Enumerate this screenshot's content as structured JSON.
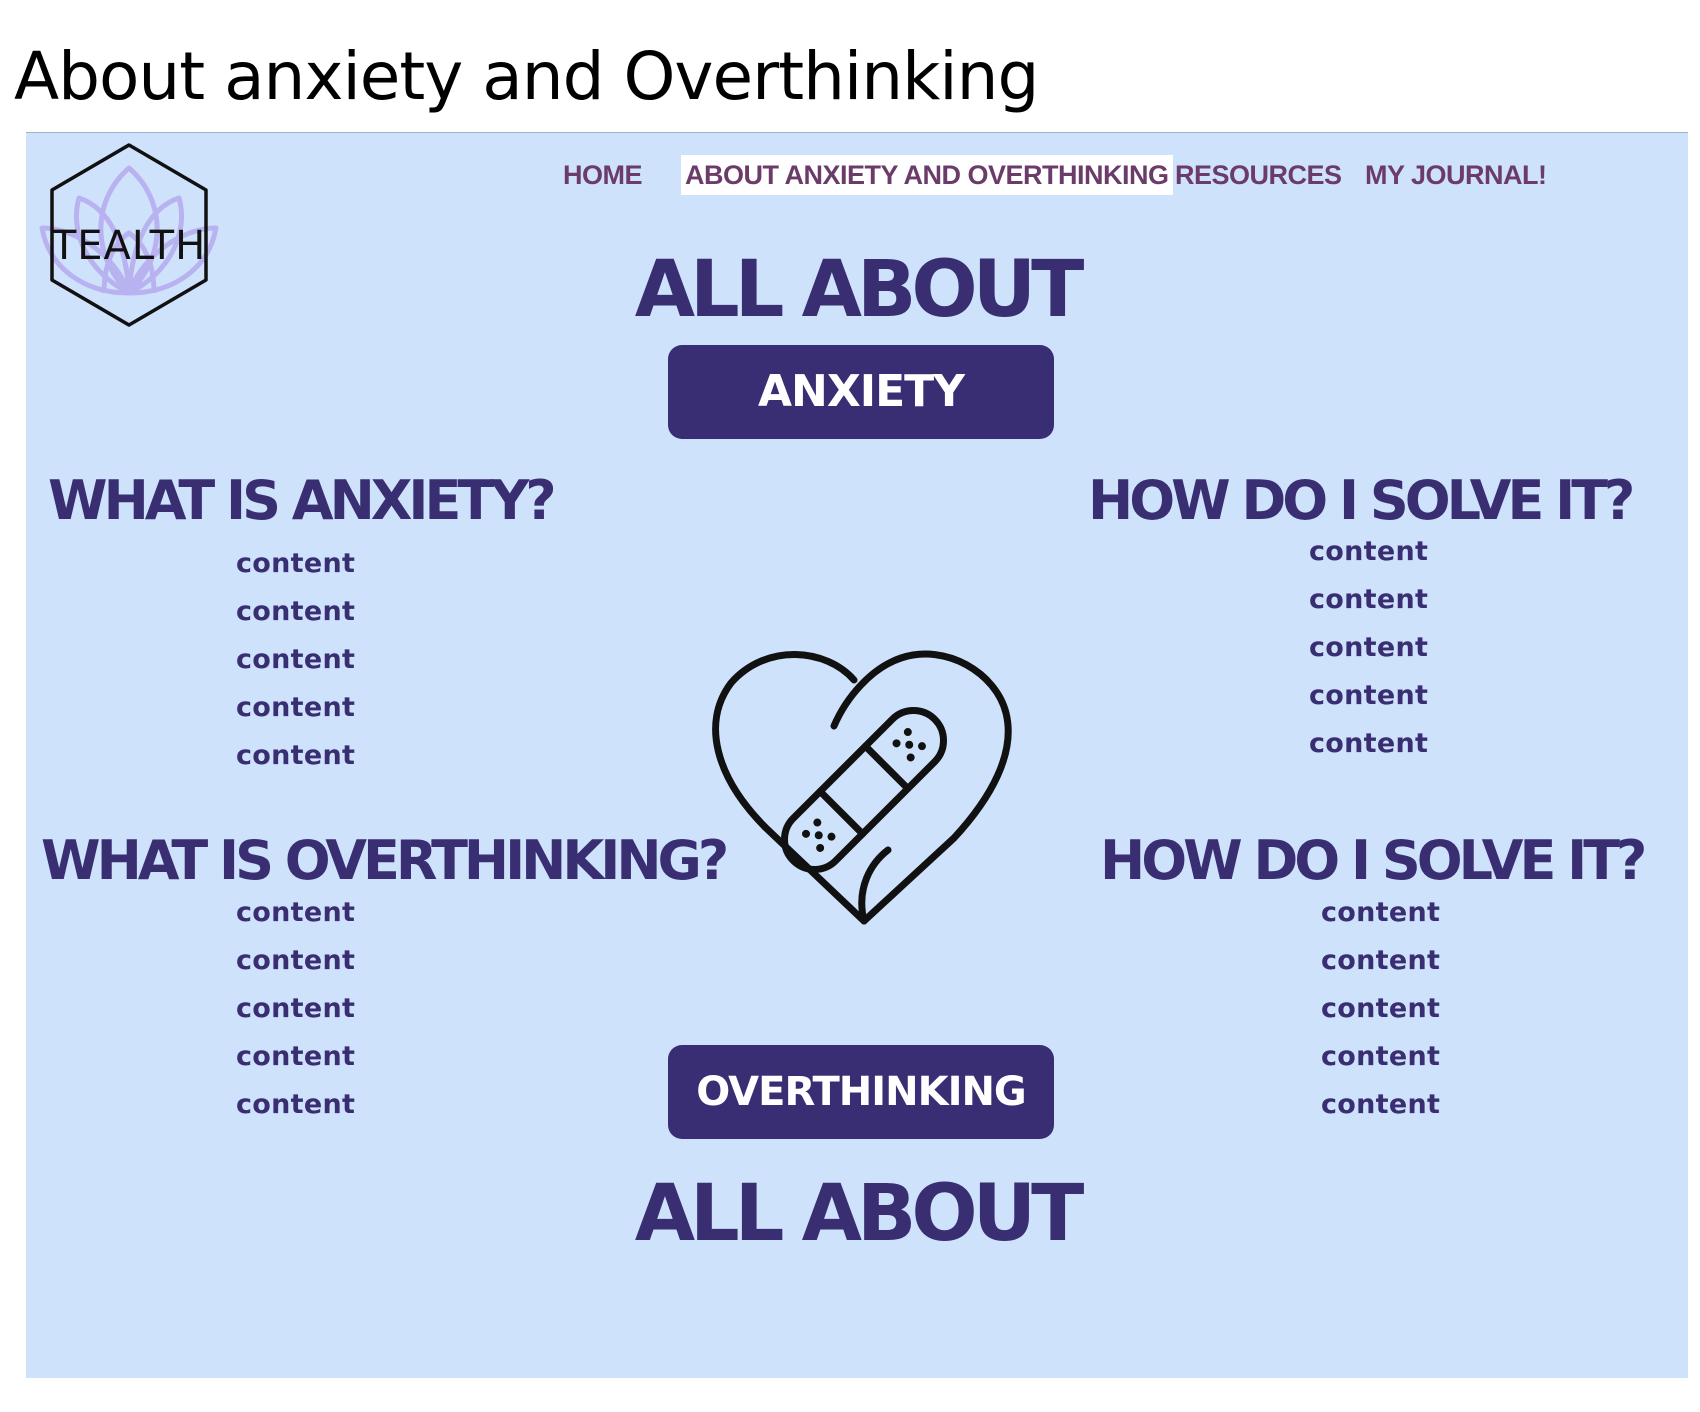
{
  "slide": {
    "title": "About anxiety and Overthinking"
  },
  "logo": {
    "text": "TEALTH"
  },
  "nav": {
    "items": [
      {
        "label": "HOME"
      },
      {
        "label": "ABOUT ANXIETY AND OVERTHINKING",
        "active": true
      },
      {
        "label": "RESOURCES"
      },
      {
        "label": "MY JOURNAL!"
      }
    ]
  },
  "anxiety": {
    "all_about": "ALL ABOUT",
    "pill_label": "ANXIETY",
    "what_heading": "WHAT IS ANXIETY?",
    "what_items": [
      "content",
      "content",
      "content",
      "content",
      "content"
    ],
    "solve_heading": "HOW DO I SOLVE IT?",
    "solve_items": [
      "content",
      "content",
      "content",
      "content",
      "content"
    ]
  },
  "overthinking": {
    "all_about": "ALL ABOUT",
    "pill_label": "OVERTHINKING",
    "what_heading": "WHAT IS OVERTHINKING?",
    "what_items": [
      "content",
      "content",
      "content",
      "content",
      "content"
    ],
    "solve_heading": "HOW DO I SOLVE IT?",
    "solve_items": [
      "content",
      "content",
      "content",
      "content",
      "content"
    ]
  },
  "icons": {
    "logo": "lotus-hexagon-icon",
    "center": "heart-bandage-icon"
  },
  "colors": {
    "background": "#cfe2fb",
    "heading": "#3a2e73",
    "pill": "#392e74",
    "nav": "#6b3c6a",
    "lotus": "#b9b2f0"
  }
}
